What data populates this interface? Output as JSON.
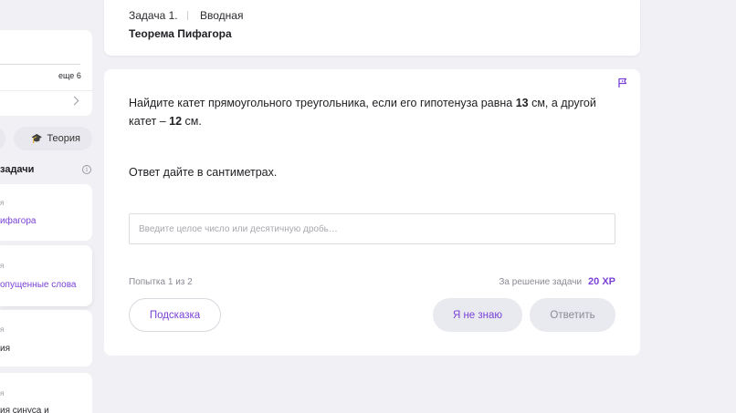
{
  "sidebar": {
    "more_label": "еще 6",
    "theory_pill_label": "Теория",
    "tasks_heading": "задачи",
    "tasks": [
      {
        "kind": "я",
        "name": "ифагора"
      },
      {
        "kind": "я",
        "name": "опущенные слова"
      },
      {
        "kind": "я",
        "name": "ия"
      },
      {
        "kind": "я",
        "name": "ия синуса и"
      }
    ]
  },
  "header": {
    "task_label": "Задача 1.",
    "task_type": "Вводная",
    "topic": "Теорема Пифагора"
  },
  "problem": {
    "text_part1": "Найдите катет прямоугольного треугольника, если его гипотенуза равна ",
    "hypotenuse": "13",
    "text_part2": " см, а другой катет – ",
    "leg": "12",
    "text_part3": " см.",
    "answer_hint": "Ответ дайте в сантиметрах."
  },
  "answer": {
    "placeholder": "Введите целое число или десятичную дробь…",
    "value": ""
  },
  "footer": {
    "attempts": "Попытка 1 из 2",
    "reward_label": "За решение задачи",
    "reward_xp": "20 XP",
    "hint_button": "Подсказка",
    "dont_know_button": "Я не знаю",
    "submit_button": "Ответить"
  },
  "colors": {
    "accent": "#7a42d6",
    "background": "#f1f1f5",
    "button_gray": "#e9e9f0"
  }
}
